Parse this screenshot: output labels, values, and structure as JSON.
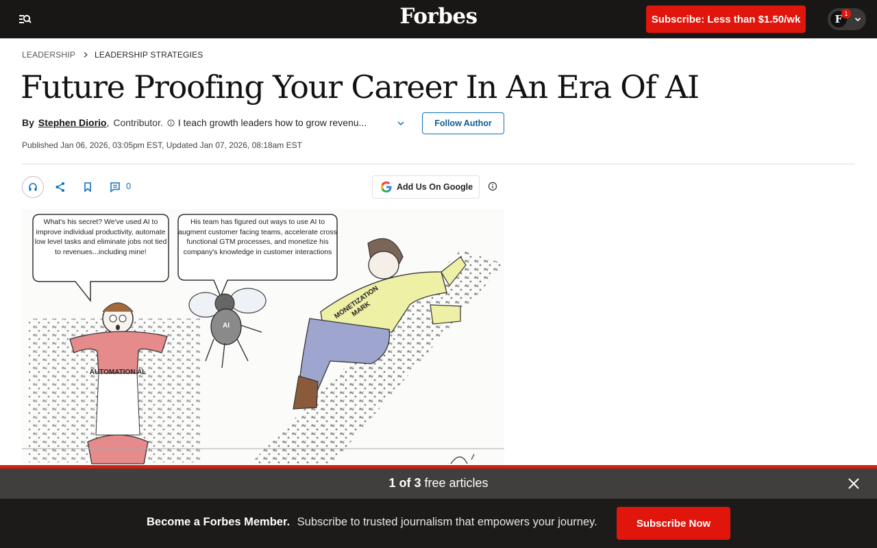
{
  "header": {
    "logo": "Forbes",
    "subscribe_label": "Subscribe: Less than $1.50/wk",
    "account_initial": "F",
    "notification_count": "1",
    "menu_icon": "search-menu-icon",
    "account_icon": "chevron-down-icon"
  },
  "breadcrumb": {
    "section": "LEADERSHIP",
    "subsection": "LEADERSHIP STRATEGIES"
  },
  "article": {
    "title": "Future Proofing Your Career In An Era Of AI",
    "by_label": "By",
    "author": "Stephen Diorio",
    "comma": ",",
    "role": "Contributor.",
    "bio": "I teach growth leaders how to grow revenu...",
    "follow_label": "Follow Author",
    "published": "Published Jan 06, 2026, 03:05pm EST, Updated Jan 07, 2026, 08:18am EST"
  },
  "actions": {
    "comment_count": "0",
    "google_label": "Add Us On Google",
    "icons": [
      "headphones-icon",
      "share-icon",
      "bookmark-icon",
      "comment-icon",
      "google-icon",
      "info-icon"
    ]
  },
  "illustration": {
    "bubble_left": "What's his secret? We've used AI to improve individual productivity, automate low level tasks and eliminate jobs not tied to revenues...including mine!",
    "bubble_right": "His team has figured out ways to use AI to augment customer facing teams, accelerate cross functional GTM processes, and monetize his company's knowledge in customer interactions",
    "label_al": "AUTOMATION AL",
    "label_fly": "AI",
    "label_mark": "MONETIZATION MARK"
  },
  "paywall": {
    "count_bold": "1 of 3",
    "count_rest": "free articles",
    "member_lead": "Become a Forbes Member.",
    "member_text": "Subscribe to trusted journalism that empowers your journey.",
    "subscribe_now": "Subscribe Now"
  },
  "colors": {
    "accent_red": "#e0160d",
    "link_blue": "#0b6fb8",
    "header_bg": "#181716"
  }
}
